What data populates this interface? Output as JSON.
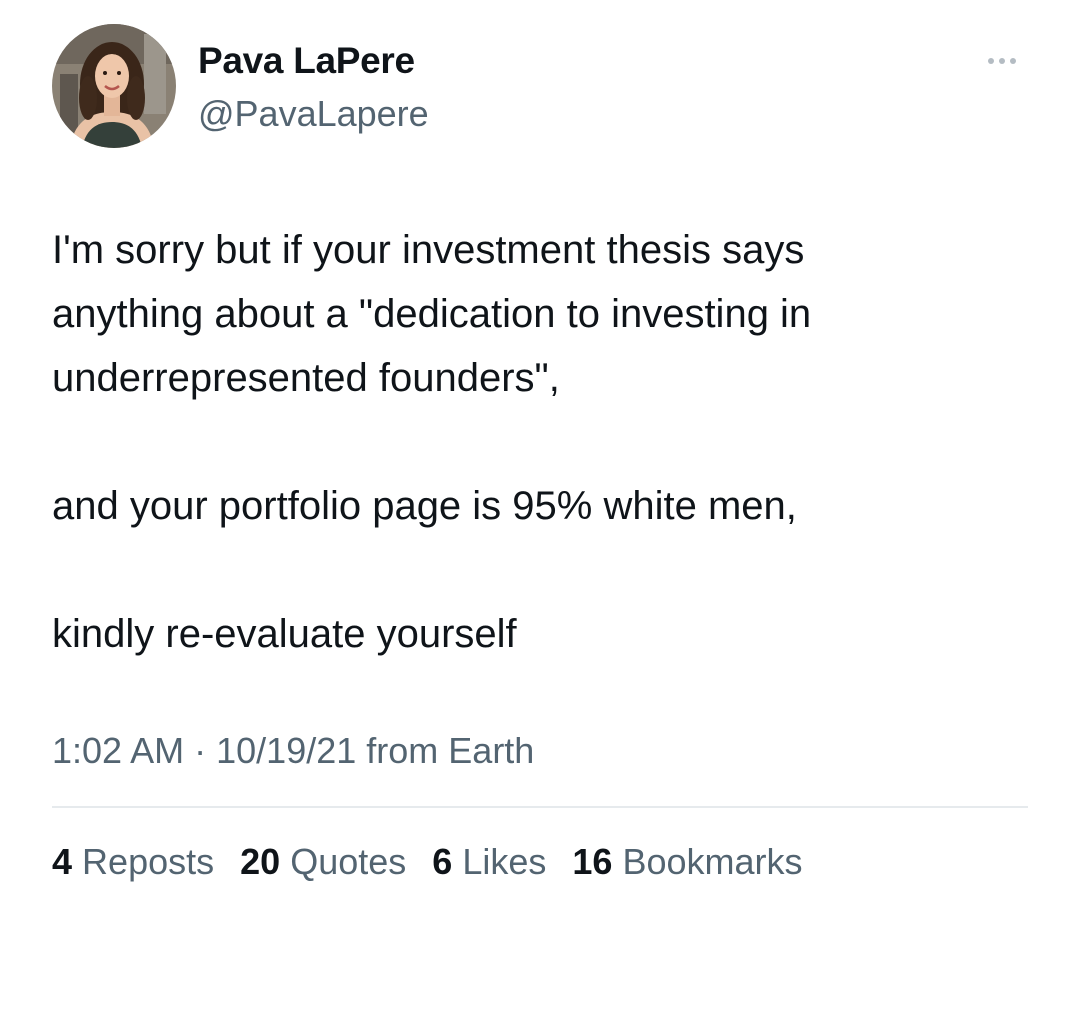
{
  "user": {
    "display_name": "Pava LaPere",
    "handle": "@PavaLapere",
    "avatar": "profile-photo"
  },
  "menu": {
    "icon": "more-horizontal-icon"
  },
  "tweet": {
    "paragraphs": [
      "I'm sorry but if your investment thesis says\nanything about a \"dedication to investing in\nunderrepresented founders\",",
      "and your portfolio page is 95% white men,",
      "kindly re-evaluate yourself"
    ]
  },
  "meta": {
    "time": "1:02 AM",
    "separator": "·",
    "date": "10/19/21",
    "source": "from Earth"
  },
  "stats": [
    {
      "count": "4",
      "label": "Reposts"
    },
    {
      "count": "20",
      "label": "Quotes"
    },
    {
      "count": "6",
      "label": "Likes"
    },
    {
      "count": "16",
      "label": "Bookmarks"
    }
  ],
  "colors": {
    "text_primary": "#0f1419",
    "text_secondary": "#536471",
    "divider": "#e6eaed",
    "background": "#ffffff"
  }
}
